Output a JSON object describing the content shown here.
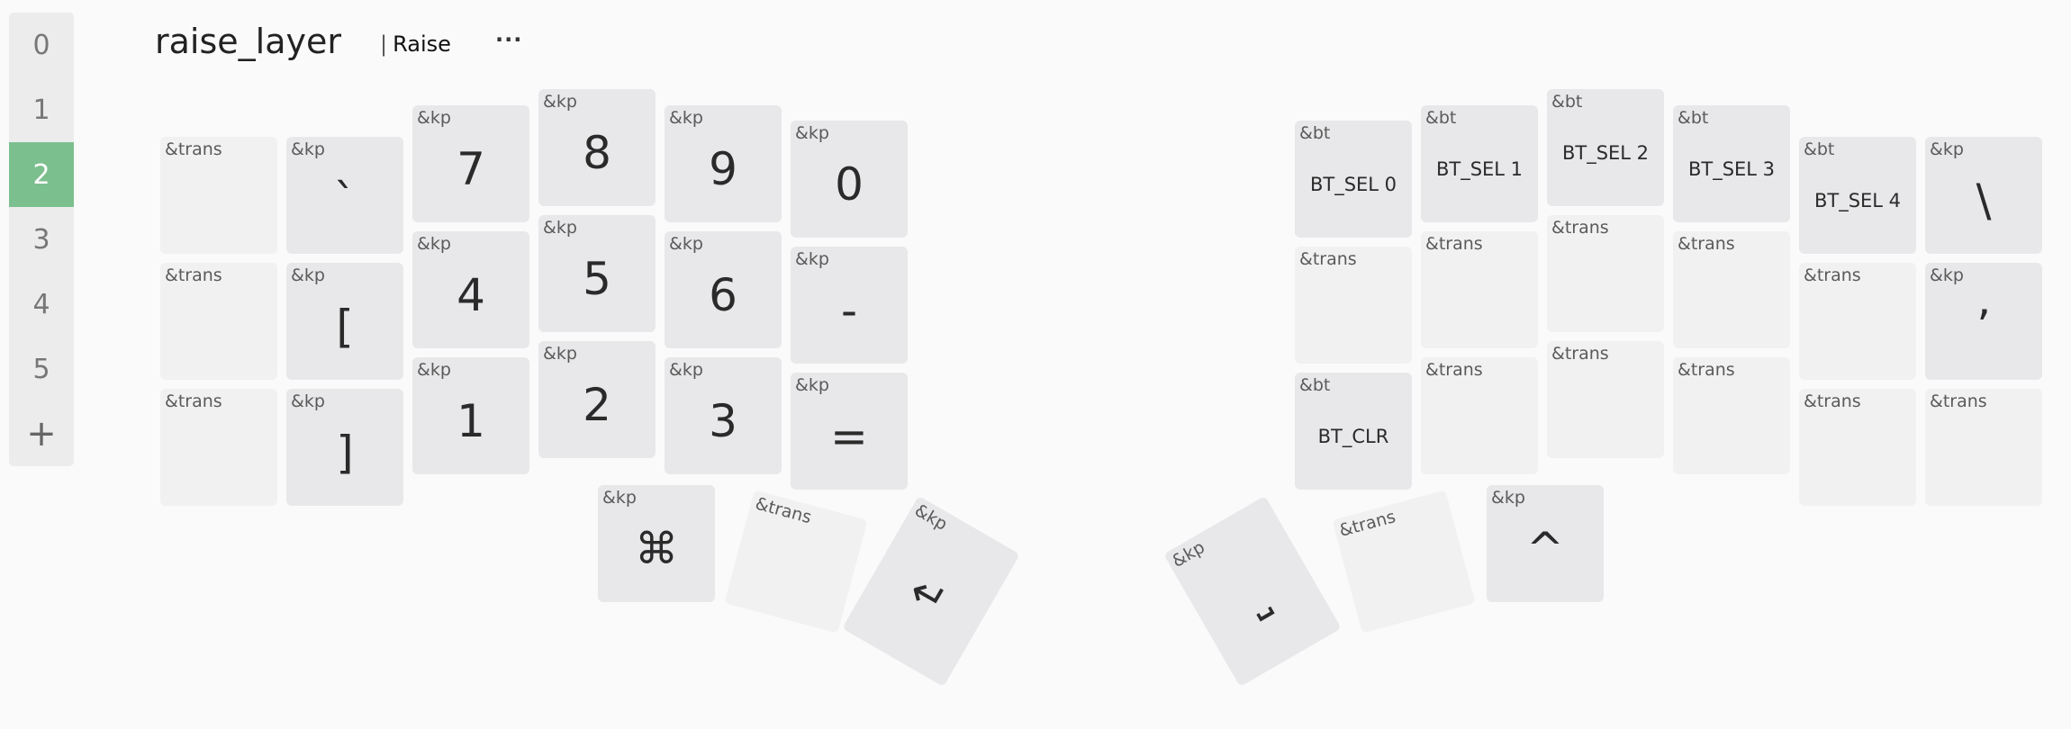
{
  "layer_tabs": [
    "0",
    "1",
    "2",
    "3",
    "4",
    "5",
    "+"
  ],
  "active_layer": "2",
  "layer": {
    "name": "raise_layer",
    "label": "Raise",
    "label_separator": "|",
    "more": "···"
  },
  "colors": {
    "active_tab": "#7cbf8e",
    "key": "#e8e8ea",
    "trans_key": "#f1f1f2"
  },
  "keys": [
    {
      "binding": "&trans",
      "param": ""
    },
    {
      "binding": "&kp",
      "param": "`"
    },
    {
      "binding": "&kp",
      "param": "7"
    },
    {
      "binding": "&kp",
      "param": "8"
    },
    {
      "binding": "&kp",
      "param": "9"
    },
    {
      "binding": "&kp",
      "param": "0"
    },
    {
      "binding": "&bt",
      "param": "BT_SEL 0"
    },
    {
      "binding": "&bt",
      "param": "BT_SEL 1"
    },
    {
      "binding": "&bt",
      "param": "BT_SEL 2"
    },
    {
      "binding": "&bt",
      "param": "BT_SEL 3"
    },
    {
      "binding": "&bt",
      "param": "BT_SEL 4"
    },
    {
      "binding": "&kp",
      "param": "\\"
    },
    {
      "binding": "&trans",
      "param": ""
    },
    {
      "binding": "&kp",
      "param": "["
    },
    {
      "binding": "&kp",
      "param": "4"
    },
    {
      "binding": "&kp",
      "param": "5"
    },
    {
      "binding": "&kp",
      "param": "6"
    },
    {
      "binding": "&kp",
      "param": "-"
    },
    {
      "binding": "&trans",
      "param": ""
    },
    {
      "binding": "&trans",
      "param": ""
    },
    {
      "binding": "&trans",
      "param": ""
    },
    {
      "binding": "&trans",
      "param": ""
    },
    {
      "binding": "&trans",
      "param": ""
    },
    {
      "binding": "&kp",
      "param": "’"
    },
    {
      "binding": "&trans",
      "param": ""
    },
    {
      "binding": "&kp",
      "param": "]"
    },
    {
      "binding": "&kp",
      "param": "1"
    },
    {
      "binding": "&kp",
      "param": "2"
    },
    {
      "binding": "&kp",
      "param": "3"
    },
    {
      "binding": "&kp",
      "param": "="
    },
    {
      "binding": "&bt",
      "param": "BT_CLR"
    },
    {
      "binding": "&trans",
      "param": ""
    },
    {
      "binding": "&trans",
      "param": ""
    },
    {
      "binding": "&trans",
      "param": ""
    },
    {
      "binding": "&trans",
      "param": ""
    },
    {
      "binding": "&trans",
      "param": ""
    },
    {
      "binding": "&kp",
      "param": "⌘",
      "icon": "command-icon"
    },
    {
      "binding": "&trans",
      "param": ""
    },
    {
      "binding": "&kp",
      "param": "↵",
      "icon": "return-icon"
    },
    {
      "binding": "&kp",
      "param": "⎵",
      "icon": "space-icon"
    },
    {
      "binding": "&trans",
      "param": ""
    },
    {
      "binding": "&kp",
      "param": "^"
    }
  ]
}
